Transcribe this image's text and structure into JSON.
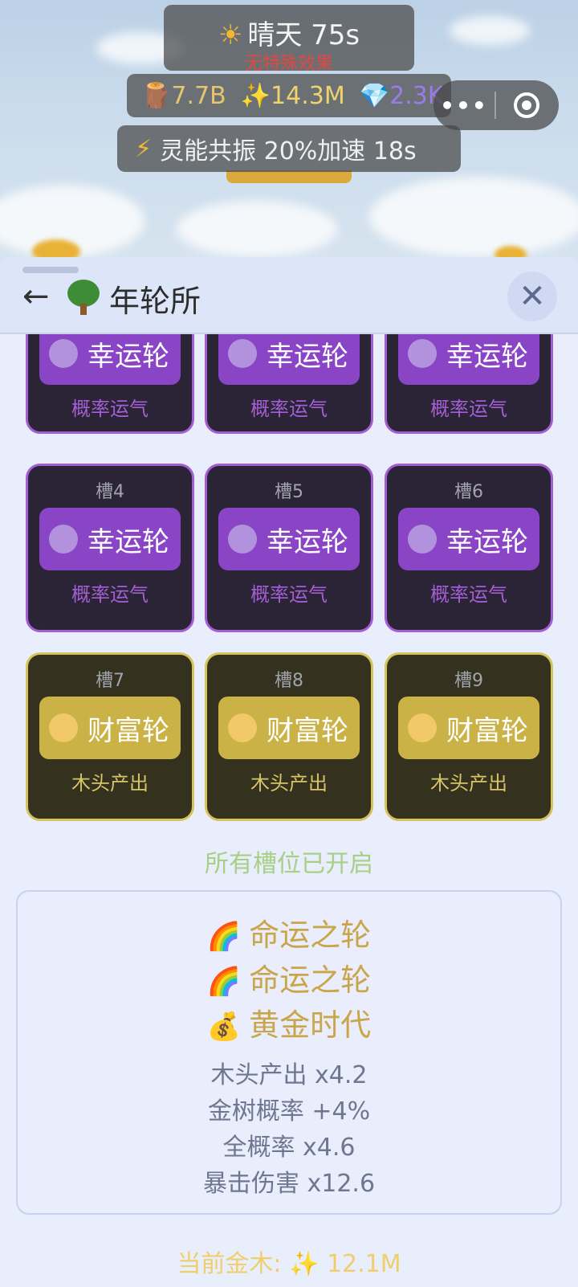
{
  "weather": {
    "icon": "sun-icon",
    "title": "晴天 75s",
    "effect": "无特殊效果"
  },
  "resources": [
    {
      "icon": "wood-log-icon",
      "value": "7.7B"
    },
    {
      "icon": "sparkle-icon",
      "value": "14.3M"
    },
    {
      "icon": "diamond-icon",
      "value": "2.3K"
    }
  ],
  "boost": {
    "icon": "lightning-icon",
    "text": "灵能共振 20%加速 18s"
  },
  "capsule": {
    "more": "•••",
    "close": "target-icon"
  },
  "header": {
    "back": "←",
    "icon": "tree-icon",
    "title": "年轮所",
    "close": "✕"
  },
  "slots": [
    {
      "name": "",
      "wheel": "幸运轮",
      "desc": "概率运气",
      "color": "purple"
    },
    {
      "name": "",
      "wheel": "幸运轮",
      "desc": "概率运气",
      "color": "purple"
    },
    {
      "name": "",
      "wheel": "幸运轮",
      "desc": "概率运气",
      "color": "purple"
    },
    {
      "name": "槽4",
      "wheel": "幸运轮",
      "desc": "概率运气",
      "color": "purple"
    },
    {
      "name": "槽5",
      "wheel": "幸运轮",
      "desc": "概率运气",
      "color": "purple"
    },
    {
      "name": "槽6",
      "wheel": "幸运轮",
      "desc": "概率运气",
      "color": "purple"
    },
    {
      "name": "槽7",
      "wheel": "财富轮",
      "desc": "木头产出",
      "color": "gold"
    },
    {
      "name": "槽8",
      "wheel": "财富轮",
      "desc": "木头产出",
      "color": "gold"
    },
    {
      "name": "槽9",
      "wheel": "财富轮",
      "desc": "木头产出",
      "color": "gold"
    }
  ],
  "all_open": "所有槽位已开启",
  "summary": {
    "effects": [
      {
        "emoji": "🌈",
        "text": "命运之轮"
      },
      {
        "emoji": "🌈",
        "text": "命运之轮"
      },
      {
        "emoji": "💰",
        "text": "黄金时代"
      }
    ],
    "stats": [
      "木头产出 x4.2",
      "金树概率 +4%",
      "全概率 x4.6",
      "暴击伤害 x12.6"
    ]
  },
  "current_gold": {
    "label": "当前金木:",
    "icon": "sparkle-icon",
    "value": "12.1M"
  }
}
